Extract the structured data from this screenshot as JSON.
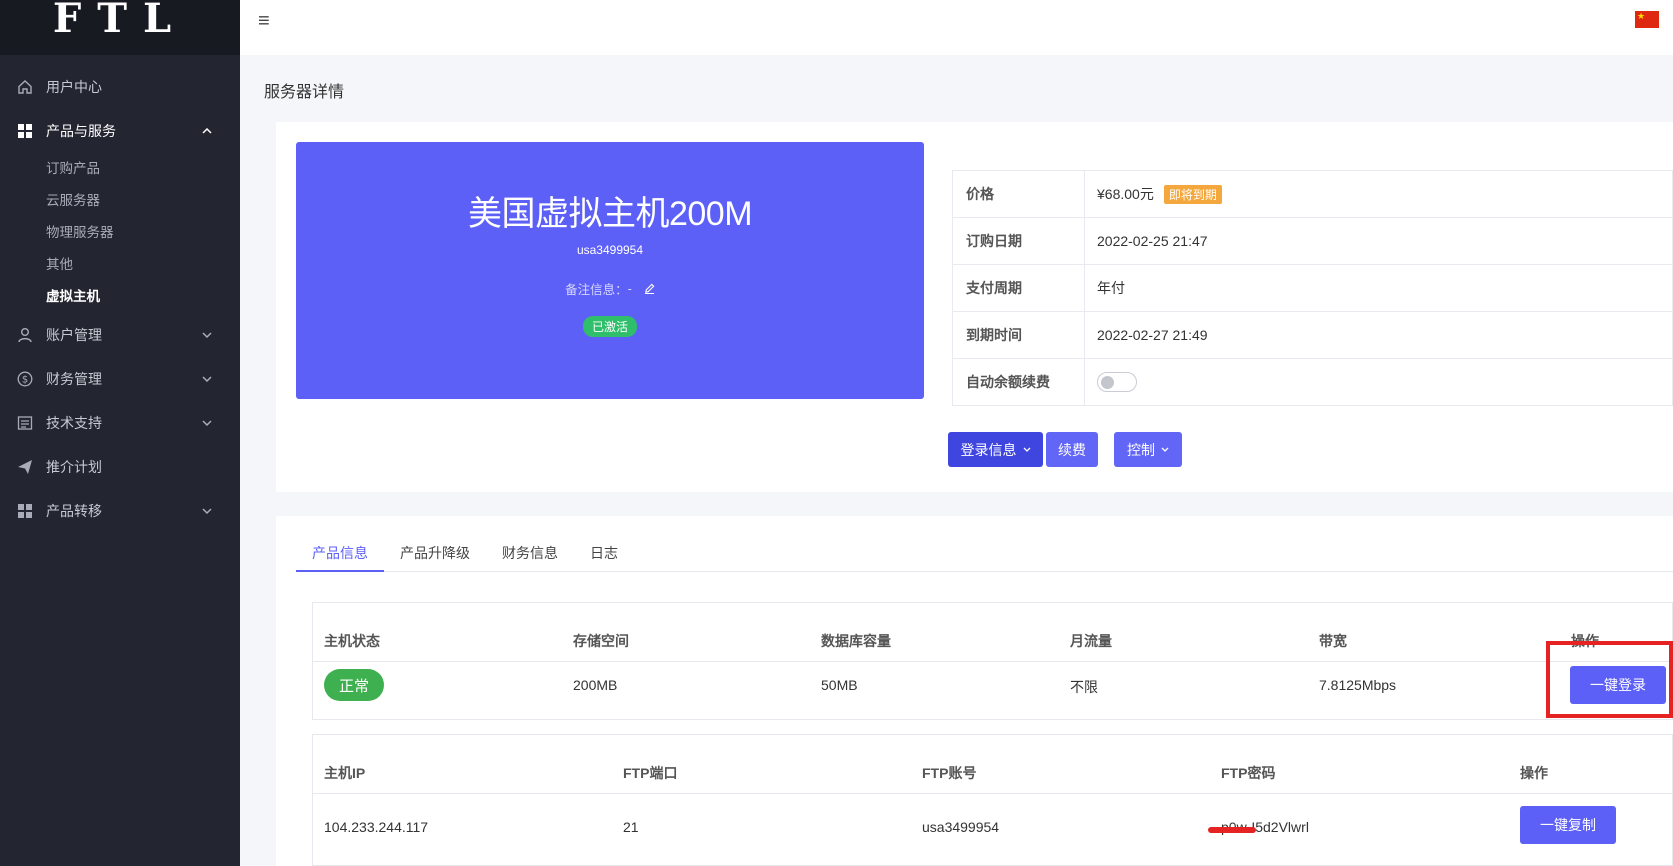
{
  "app": {
    "logo": "FTL"
  },
  "sidebar": {
    "items": [
      {
        "label": "用户中心",
        "icon": "home-icon"
      },
      {
        "label": "产品与服务",
        "icon": "grid-icon",
        "expanded": true,
        "children": [
          "订购产品",
          "云服务器",
          "物理服务器",
          "其他",
          "虚拟主机"
        ],
        "current_child": "虚拟主机"
      },
      {
        "label": "账户管理",
        "icon": "user-icon"
      },
      {
        "label": "财务管理",
        "icon": "dollar-icon"
      },
      {
        "label": "技术支持",
        "icon": "document-icon"
      },
      {
        "label": "推介计划",
        "icon": "paper-plane-icon"
      },
      {
        "label": "产品转移",
        "icon": "grid-icon"
      }
    ]
  },
  "page": {
    "title": "服务器详情"
  },
  "hero": {
    "product_name": "美国虚拟主机200M",
    "username": "usa3499954",
    "note_label": "备注信息：",
    "note_value": "-",
    "status_badge": "已激活"
  },
  "info": {
    "price_label": "价格",
    "price_value": "¥68.00元",
    "price_tag": "即将到期",
    "order_date_label": "订购日期",
    "order_date_value": "2022-02-25 21:47",
    "cycle_label": "支付周期",
    "cycle_value": "年付",
    "expiry_label": "到期时间",
    "expiry_value": "2022-02-27 21:49",
    "auto_renew_label": "自动余额续费",
    "auto_renew_enabled": false
  },
  "actions": {
    "login_info": "登录信息",
    "renew": "续费",
    "control": "控制"
  },
  "tabs": [
    "产品信息",
    "产品升降级",
    "财务信息",
    "日志"
  ],
  "active_tab": "产品信息",
  "host_table": {
    "headers": [
      "主机状态",
      "存储空间",
      "数据库容量",
      "月流量",
      "带宽",
      "操作"
    ],
    "row": {
      "status": "正常",
      "storage": "200MB",
      "db": "50MB",
      "traffic": "不限",
      "bandwidth": "7.8125Mbps",
      "action": "一键登录"
    }
  },
  "ftp_table": {
    "headers": [
      "主机IP",
      "FTP端口",
      "FTP账号",
      "FTP密码",
      "操作"
    ],
    "row": {
      "ip": "104.233.244.117",
      "port": "21",
      "account": "usa3499954",
      "password": "p0w-I5d2Vlwrl",
      "action": "一键复制"
    }
  },
  "colors": {
    "accent": "#5d60f7",
    "sidebar_bg": "#232530",
    "success": "#3fb04f",
    "warning": "#f3a73d",
    "highlight": "#e52323"
  }
}
